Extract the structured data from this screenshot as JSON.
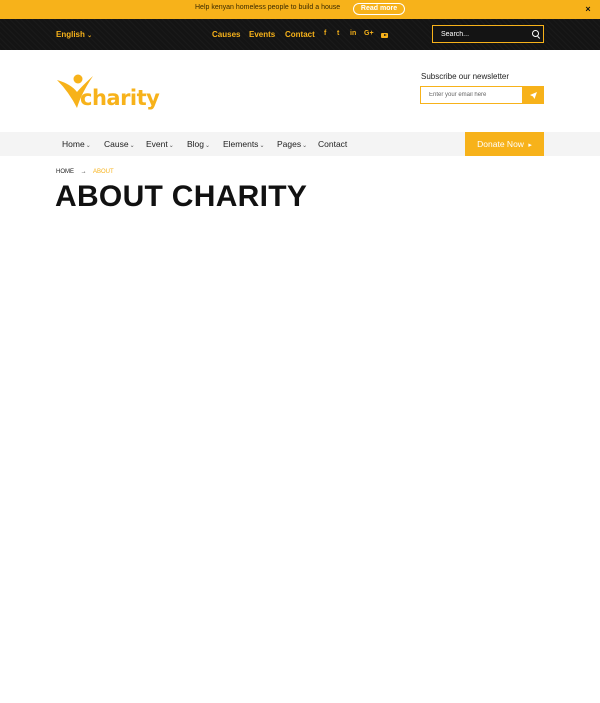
{
  "announcement": {
    "text": "Help kenyan homeless people to build a house",
    "button_label": "Read more",
    "close_label": "×"
  },
  "topbar": {
    "language": "English",
    "links": [
      "Causes",
      "Events",
      "Contact"
    ],
    "social": {
      "facebook": "f",
      "twitter": "t",
      "linkedin": "in",
      "googleplus": "G+"
    },
    "search_placeholder": "Search..."
  },
  "brand": {
    "logo_text": "charity",
    "accent_color": "#f7b21a",
    "dark_color": "#141414"
  },
  "newsletter": {
    "label": "Subscribe our newsletter",
    "placeholder": "Enter your email here"
  },
  "nav": {
    "items": [
      "Home",
      "Cause",
      "Event",
      "Blog",
      "Elements",
      "Pages",
      "Contact"
    ],
    "donate_label": "Donate Now"
  },
  "breadcrumb": {
    "home": "HOME",
    "separator": "→",
    "current": "ABOUT"
  },
  "page": {
    "title": "ABOUT CHARITY"
  }
}
